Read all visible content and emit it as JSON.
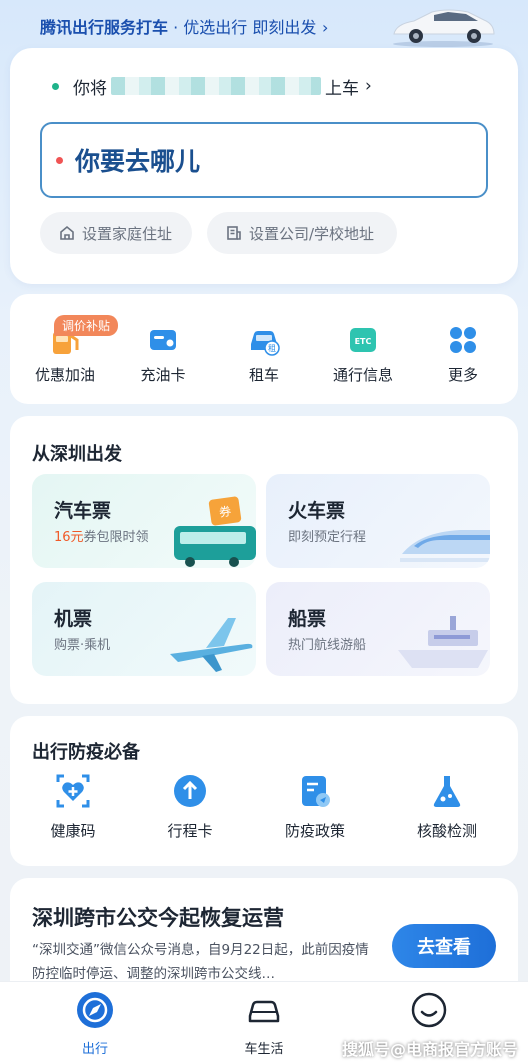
{
  "banner": {
    "brand": "腾讯出行服务打车",
    "separator": " · ",
    "slogan": "优选出行 即刻出发",
    "arrow": "›"
  },
  "origin": {
    "prefix": "你将",
    "suffix": "上车",
    "arrow": "›"
  },
  "destination": {
    "placeholder": "你要去哪儿"
  },
  "quick_addresses": [
    {
      "label": "设置家庭住址",
      "icon": "home-icon"
    },
    {
      "label": "设置公司/学校地址",
      "icon": "building-icon"
    }
  ],
  "services": {
    "badge": "调价补贴",
    "items": [
      {
        "label": "优惠加油",
        "icon": "fuel-icon"
      },
      {
        "label": "充油卡",
        "icon": "fuel-card-icon"
      },
      {
        "label": "租车",
        "icon": "car-rental-icon"
      },
      {
        "label": "通行信息",
        "icon": "etc-icon"
      },
      {
        "label": "更多",
        "icon": "grid-more-icon"
      }
    ]
  },
  "departures": {
    "title": "从深圳出发",
    "tickets": [
      {
        "title": "汽车票",
        "highlight": "16元",
        "subtitle": "券包限时领",
        "icon": "bus-icon",
        "coupon": "券"
      },
      {
        "title": "火车票",
        "highlight": "",
        "subtitle": "即刻预定行程",
        "icon": "train-icon"
      },
      {
        "title": "机票",
        "highlight": "",
        "subtitle": "购票·乘机",
        "icon": "plane-icon"
      },
      {
        "title": "船票",
        "highlight": "",
        "subtitle": "热门航线游船",
        "icon": "ship-icon"
      }
    ]
  },
  "epidemic": {
    "title": "出行防疫必备",
    "items": [
      {
        "label": "健康码",
        "icon": "health-code-icon"
      },
      {
        "label": "行程卡",
        "icon": "itinerary-card-icon"
      },
      {
        "label": "防疫政策",
        "icon": "policy-icon"
      },
      {
        "label": "核酸检测",
        "icon": "test-flask-icon"
      }
    ]
  },
  "news": {
    "title": "深圳跨市公交今起恢复运营",
    "body": "“深圳交通”微信公众号消息，自9月22日起，此前因疫情防控临时停运、调整的深圳跨市公交线…",
    "button": "去查看"
  },
  "bottom_nav": [
    {
      "label": "出行",
      "icon": "compass-icon",
      "active": true
    },
    {
      "label": "车生活",
      "icon": "car-icon",
      "active": false
    },
    {
      "label": "",
      "icon": "smile-icon",
      "active": false
    }
  ],
  "watermark": "搜狐号@电商报官方账号",
  "colors": {
    "primary": "#1e6fd8",
    "accent_orange": "#f05a28",
    "origin_dot": "#1fb38a",
    "dest_dot": "#f05454"
  }
}
